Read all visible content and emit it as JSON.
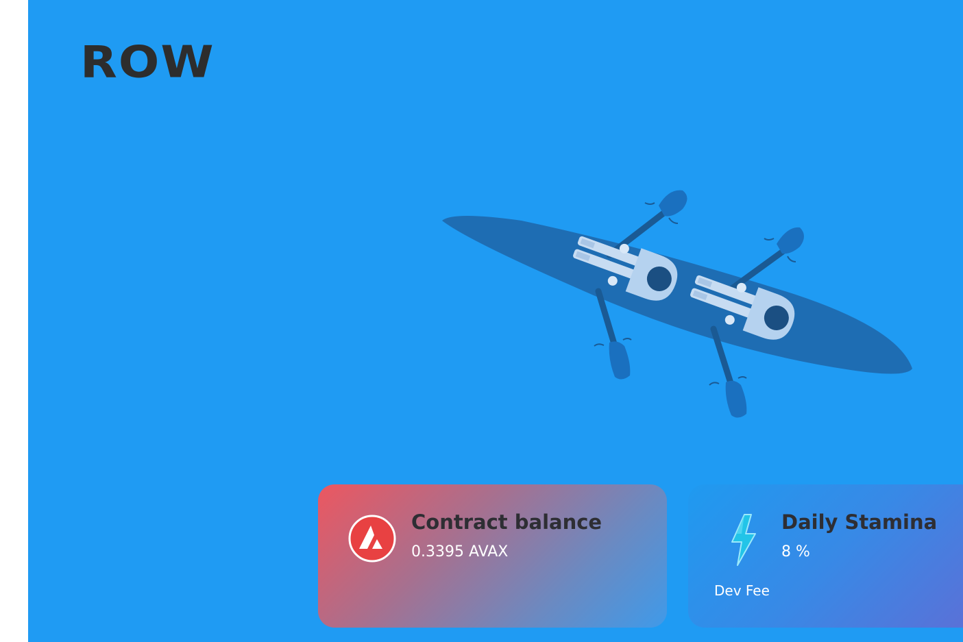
{
  "brand": {
    "logo_text": "ROW"
  },
  "colors": {
    "hero_background": "#1f9bf3",
    "logo": "#2d2d2d",
    "boat_hull": "#1e6db3",
    "avax_red": "#e84142"
  },
  "illustration": {
    "subject": "two-person rowing boat seen from above",
    "icon": "rowing-boat-illustration"
  },
  "cards": {
    "balance": {
      "title": "Contract balance",
      "value": "0.3395 AVAX",
      "icon": "avalanche-icon"
    },
    "stamina": {
      "title": "Daily Stamina",
      "value": "8 %",
      "subtitle": "Dev Fee",
      "icon": "lightning-bolt-icon"
    }
  }
}
